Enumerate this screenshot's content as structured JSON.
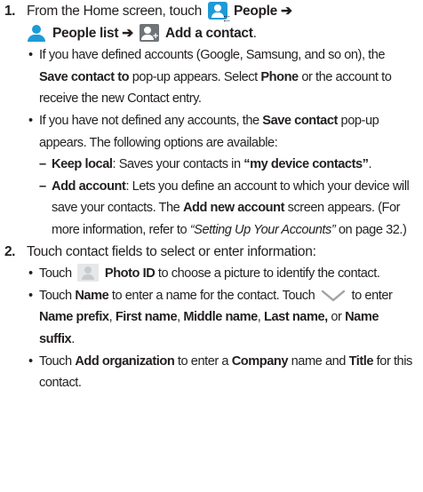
{
  "step1": {
    "number": "1.",
    "intro": "From the Home screen, touch",
    "people": "People",
    "arrow": "➔",
    "people_list": "People list",
    "add_contact": "Add a contact",
    "period": ".",
    "bullet1": {
      "t1": "If you have defined accounts (Google, Samsung, and so on), the",
      "save_to": "Save contact to",
      "t2": "pop-up appears. Select",
      "phone": "Phone",
      "t3": "or the account to receive the new Contact entry."
    },
    "bullet2": {
      "t1": "If you have not defined any accounts, the",
      "save": "Save contact",
      "t2": "pop-up appears. The following options are available:"
    },
    "dash_mark": "–",
    "dash1": {
      "label": "Keep local",
      "t1": ": Saves your contacts in",
      "quoted": "“my device contacts”",
      "t2": "."
    },
    "dash2": {
      "label": "Add account",
      "t1": ": Lets you define an account to which your device will save your contacts. The",
      "new_acct": "Add new account",
      "t2": "screen appears. (For more information, refer to",
      "ref": "“Setting Up Your Accounts”",
      "t3": "on page 32.)"
    }
  },
  "step2": {
    "number": "2.",
    "intro": "Touch contact fields to select or enter information:",
    "b1": {
      "t1": "Touch",
      "photo": "Photo ID",
      "t2": "to choose a picture to identify the contact."
    },
    "b2": {
      "t1": "Touch",
      "name": "Name",
      "t2": "to enter a name for the contact. Touch",
      "t3": "to enter",
      "prefix": "Name prefix",
      "c1": ",",
      "first": "First name",
      "c2": ",",
      "middle": "Middle name",
      "c3": ",",
      "last": "Last name,",
      "or": "or",
      "suffix": "Name suffix",
      "end": "."
    },
    "b3": {
      "t1": "Touch",
      "org": "Add organization",
      "t2": "to enter a",
      "company": "Company",
      "t3": "name and",
      "title": "Title",
      "t4": "for this contact."
    }
  },
  "icons": {
    "people": "people-app-icon",
    "people_list": "people-list-icon",
    "add_contact": "add-contact-icon",
    "photo": "photo-id-icon",
    "expand": "chevron-down-icon"
  },
  "colors": {
    "icon_blue": "#1d9bd7",
    "icon_gray": "#6f7478",
    "text": "#231f20"
  }
}
